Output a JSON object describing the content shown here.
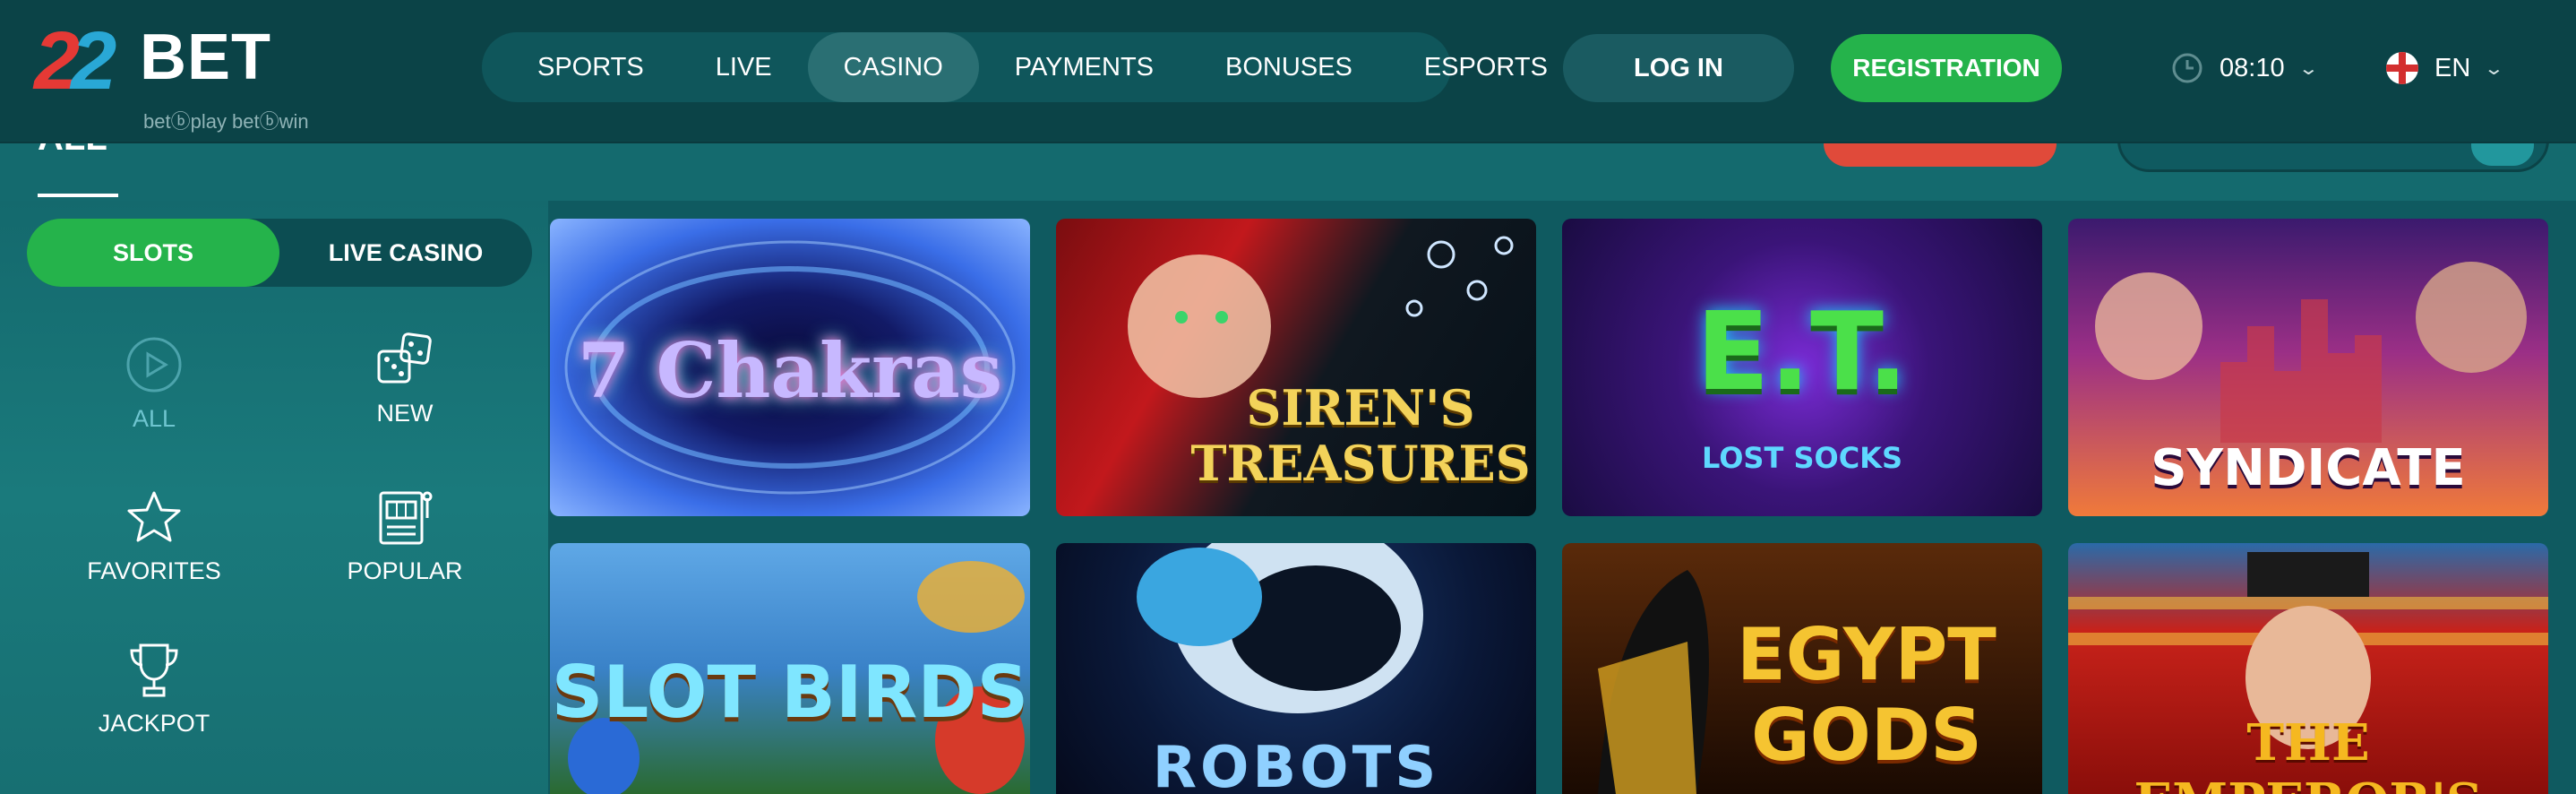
{
  "brand": {
    "number": "22",
    "name": "BET",
    "tagline": "betⓑplay  betⓑwin"
  },
  "nav": {
    "items": [
      {
        "label": "SPORTS",
        "active": false
      },
      {
        "label": "LIVE",
        "active": false
      },
      {
        "label": "CASINO",
        "active": true
      },
      {
        "label": "PAYMENTS",
        "active": false
      },
      {
        "label": "BONUSES",
        "active": false
      },
      {
        "label": "ESPORTS",
        "active": false
      }
    ]
  },
  "auth": {
    "login_label": "LOG IN",
    "register_label": "REGISTRATION"
  },
  "clock": {
    "time": "08:10"
  },
  "language": {
    "code": "EN"
  },
  "subbar": {
    "all_label": "ALL"
  },
  "sidebar": {
    "tabs": [
      {
        "label": "SLOTS",
        "active": true
      },
      {
        "label": "LIVE CASINO",
        "active": false
      }
    ],
    "categories": [
      {
        "label": "ALL",
        "icon": "play-circle-icon",
        "active": true
      },
      {
        "label": "NEW",
        "icon": "dice-icon",
        "active": false
      },
      {
        "label": "FAVORITES",
        "icon": "star-icon",
        "active": false
      },
      {
        "label": "POPULAR",
        "icon": "slot-machine-icon",
        "active": false
      },
      {
        "label": "JACKPOT",
        "icon": "trophy-icon",
        "active": false
      }
    ]
  },
  "games": [
    {
      "title": "7 Chakras"
    },
    {
      "title": "SIREN'S TREASURES"
    },
    {
      "title": "E.T.",
      "subtitle": "LOST SOCKS"
    },
    {
      "title": "SYNDICATE"
    },
    {
      "title": "SLOT BIRDS"
    },
    {
      "title": "ROBOTS"
    },
    {
      "title": "EGYPT GODS"
    },
    {
      "title": "THE EMPEROR'S"
    }
  ],
  "colors": {
    "header_bg": "#0b4347",
    "accent_green": "#25b34b",
    "brand_red": "#e53935",
    "brand_blue": "#29a8d6",
    "page_bg": "#0f5a60"
  }
}
